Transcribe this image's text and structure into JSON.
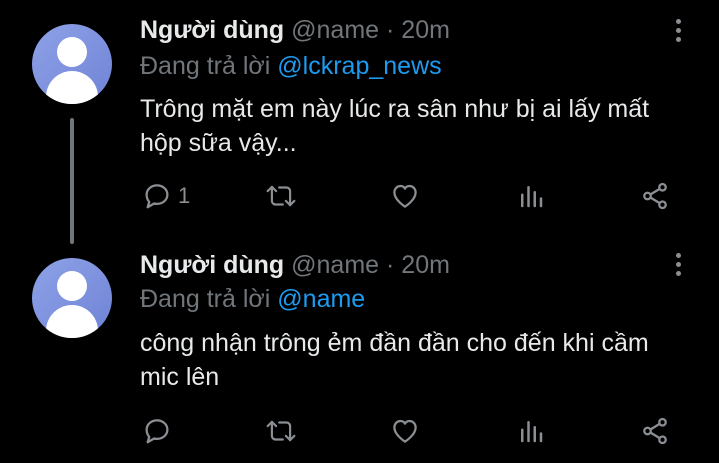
{
  "tweets": [
    {
      "display_name": "Người dùng",
      "handle": "@name",
      "separator": "·",
      "time": "20m",
      "replying_prefix": "Đang trả lời",
      "replying_to": "@lckrap_news",
      "text": "Trông mặt em này lúc ra sân như bị ai lấy mất hộp sữa vậy...",
      "reply_count": "1"
    },
    {
      "display_name": "Người dùng",
      "handle": "@name",
      "separator": "·",
      "time": "20m",
      "replying_prefix": "Đang trả lời",
      "replying_to": "@name",
      "text": "công nhận trông ẻm đần đần cho đến khi cầm mic lên",
      "reply_count": ""
    }
  ],
  "icons": {
    "avatar": "default-user-avatar",
    "more": "more-vertical-icon",
    "reply": "reply-icon",
    "retweet": "retweet-icon",
    "like": "heart-icon",
    "views": "analytics-icon",
    "share": "share-icon"
  },
  "colors": {
    "background": "#000000",
    "primary_text": "#e7e9ea",
    "secondary_text": "#71767b",
    "mention": "#1d9bf0",
    "avatar": "#7c8fdf"
  }
}
